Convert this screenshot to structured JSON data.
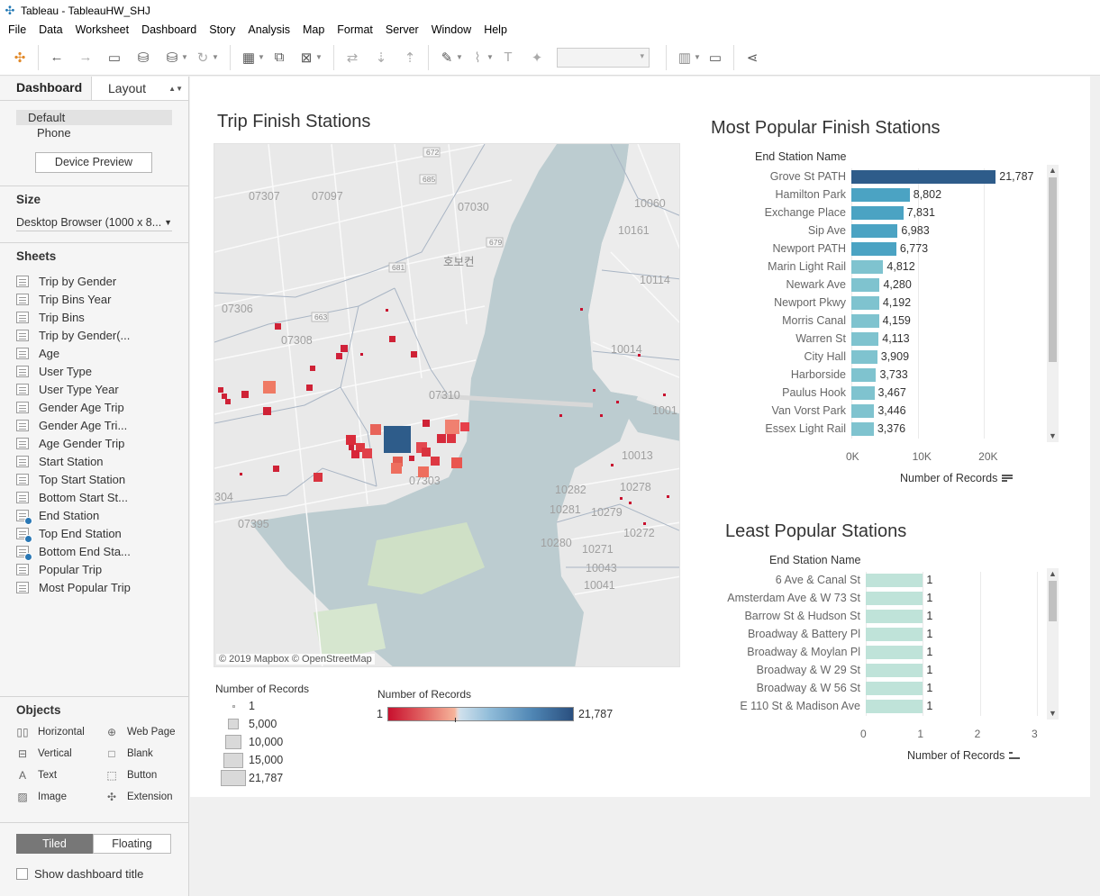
{
  "window": {
    "title": "Tableau - TableauHW_SHJ"
  },
  "menu": [
    "File",
    "Data",
    "Worksheet",
    "Dashboard",
    "Story",
    "Analysis",
    "Map",
    "Format",
    "Server",
    "Window",
    "Help"
  ],
  "left_panel": {
    "tabs": {
      "dashboard": "Dashboard",
      "layout": "Layout"
    },
    "devices": [
      "Default",
      "Phone"
    ],
    "device_preview": "Device Preview",
    "size_title": "Size",
    "size_value": "Desktop Browser (1000 x 8...",
    "sheets_title": "Sheets",
    "sheets": [
      {
        "name": "Trip by Gender",
        "used": false
      },
      {
        "name": "Trip Bins Year",
        "used": false
      },
      {
        "name": "Trip Bins",
        "used": false
      },
      {
        "name": "Trip by Gender(...",
        "used": false
      },
      {
        "name": "Age",
        "used": false
      },
      {
        "name": "User Type",
        "used": false
      },
      {
        "name": "User Type Year",
        "used": false
      },
      {
        "name": "Gender Age Trip",
        "used": false
      },
      {
        "name": "Gender Age Tri...",
        "used": false
      },
      {
        "name": "Age Gender Trip",
        "used": false
      },
      {
        "name": "Start Station",
        "used": false
      },
      {
        "name": "Top Start Station",
        "used": false
      },
      {
        "name": "Bottom Start St...",
        "used": false
      },
      {
        "name": "End Station",
        "used": true
      },
      {
        "name": "Top End Station",
        "used": true
      },
      {
        "name": "Bottom End Sta...",
        "used": true
      },
      {
        "name": "Popular Trip",
        "used": false
      },
      {
        "name": "Most Popular Trip",
        "used": false
      }
    ],
    "objects_title": "Objects",
    "objects": [
      {
        "name": "Horizontal",
        "icon": "horizontal-icon",
        "glyph": "▯▯"
      },
      {
        "name": "Web Page",
        "icon": "globe-icon",
        "glyph": "⊕"
      },
      {
        "name": "Vertical",
        "icon": "vertical-icon",
        "glyph": "⊟"
      },
      {
        "name": "Blank",
        "icon": "blank-icon",
        "glyph": "□"
      },
      {
        "name": "Text",
        "icon": "text-icon",
        "glyph": "A"
      },
      {
        "name": "Button",
        "icon": "button-icon",
        "glyph": "⬚"
      },
      {
        "name": "Image",
        "icon": "image-icon",
        "glyph": "▨"
      },
      {
        "name": "Extension",
        "icon": "extension-icon",
        "glyph": "✣"
      }
    ],
    "tiled": "Tiled",
    "floating": "Floating",
    "show_title": "Show dashboard title"
  },
  "dashboard": {
    "map_title": "Trip Finish Stations",
    "map_credit": "© 2019 Mapbox © OpenStreetMap",
    "map_labels": [
      "07307",
      "07097",
      "07030",
      "10060",
      "10161",
      "호보컨",
      "07306",
      "07308",
      "10114",
      "10014",
      "07310",
      "1001",
      "10013",
      "07303",
      "304",
      "07395",
      "10282",
      "10281",
      "10279",
      "10278",
      "10280",
      "10271",
      "10272",
      "10043",
      "10041",
      "672",
      "685",
      "679",
      "681",
      "663"
    ],
    "size_legend": {
      "title": "Number of Records",
      "entries": [
        "1",
        "5,000",
        "10,000",
        "15,000",
        "21,787"
      ]
    },
    "color_legend": {
      "title": "Number of Records",
      "min": "1",
      "max": "21,787"
    },
    "colors": {
      "dark_blue": "#2e5c8a",
      "mid_blue": "#4ba3c3",
      "light_blue": "#7fc3cf",
      "teal_light": "#bfe3d9",
      "red": "#c8102e"
    }
  },
  "chart_data": [
    {
      "type": "bar",
      "title": "Most Popular Finish Stations",
      "header": "End Station Name",
      "categories": [
        "Grove St PATH",
        "Hamilton Park",
        "Exchange Place",
        "Sip Ave",
        "Newport PATH",
        "Marin Light Rail",
        "Newark Ave",
        "Newport Pkwy",
        "Morris Canal",
        "Warren St",
        "City Hall",
        "Harborside",
        "Paulus Hook",
        "Van Vorst Park",
        "Essex Light Rail"
      ],
      "values": [
        21787,
        8802,
        7831,
        6983,
        6773,
        4812,
        4280,
        4192,
        4159,
        4113,
        3909,
        3733,
        3467,
        3446,
        3376
      ],
      "value_labels": [
        "21,787",
        "8,802",
        "7,831",
        "6,983",
        "6,773",
        "4,812",
        "4,280",
        "4,192",
        "4,159",
        "4,113",
        "3,909",
        "3,733",
        "3,467",
        "3,446",
        "3,376"
      ],
      "xticks": [
        "0K",
        "10K",
        "20K"
      ],
      "xlim": [
        0,
        28000
      ],
      "xlabel": "Number of Records"
    },
    {
      "type": "bar",
      "title": "Least Popular Stations",
      "header": "End Station Name",
      "categories": [
        "6 Ave & Canal St",
        "Amsterdam Ave & W 73 St",
        "Barrow St & Hudson St",
        "Broadway & Battery Pl",
        "Broadway & Moylan Pl",
        "Broadway & W 29 St",
        "Broadway & W 56 St",
        "E 110 St & Madison Ave"
      ],
      "values": [
        1,
        1,
        1,
        1,
        1,
        1,
        1,
        1
      ],
      "value_labels": [
        "1",
        "1",
        "1",
        "1",
        "1",
        "1",
        "1",
        "1"
      ],
      "xticks": [
        "0",
        "1",
        "2",
        "3"
      ],
      "xlim": [
        0,
        3
      ],
      "xlabel": "Number of Records"
    }
  ]
}
